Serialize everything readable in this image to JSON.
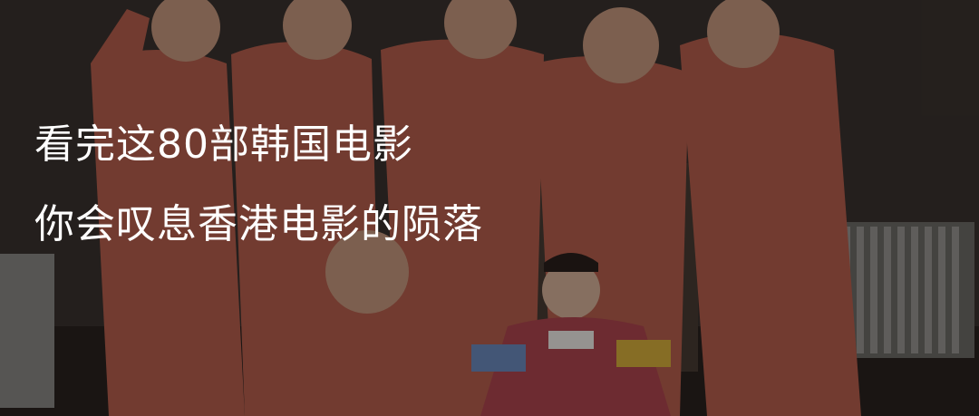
{
  "banner": {
    "headline_line1": "看完这80部韩国电影",
    "headline_line2": "你会叹息香港电影的陨落"
  },
  "colors": {
    "text": "#ffffff",
    "uniform": "#b8604e",
    "background_wall": "#3a322e"
  }
}
